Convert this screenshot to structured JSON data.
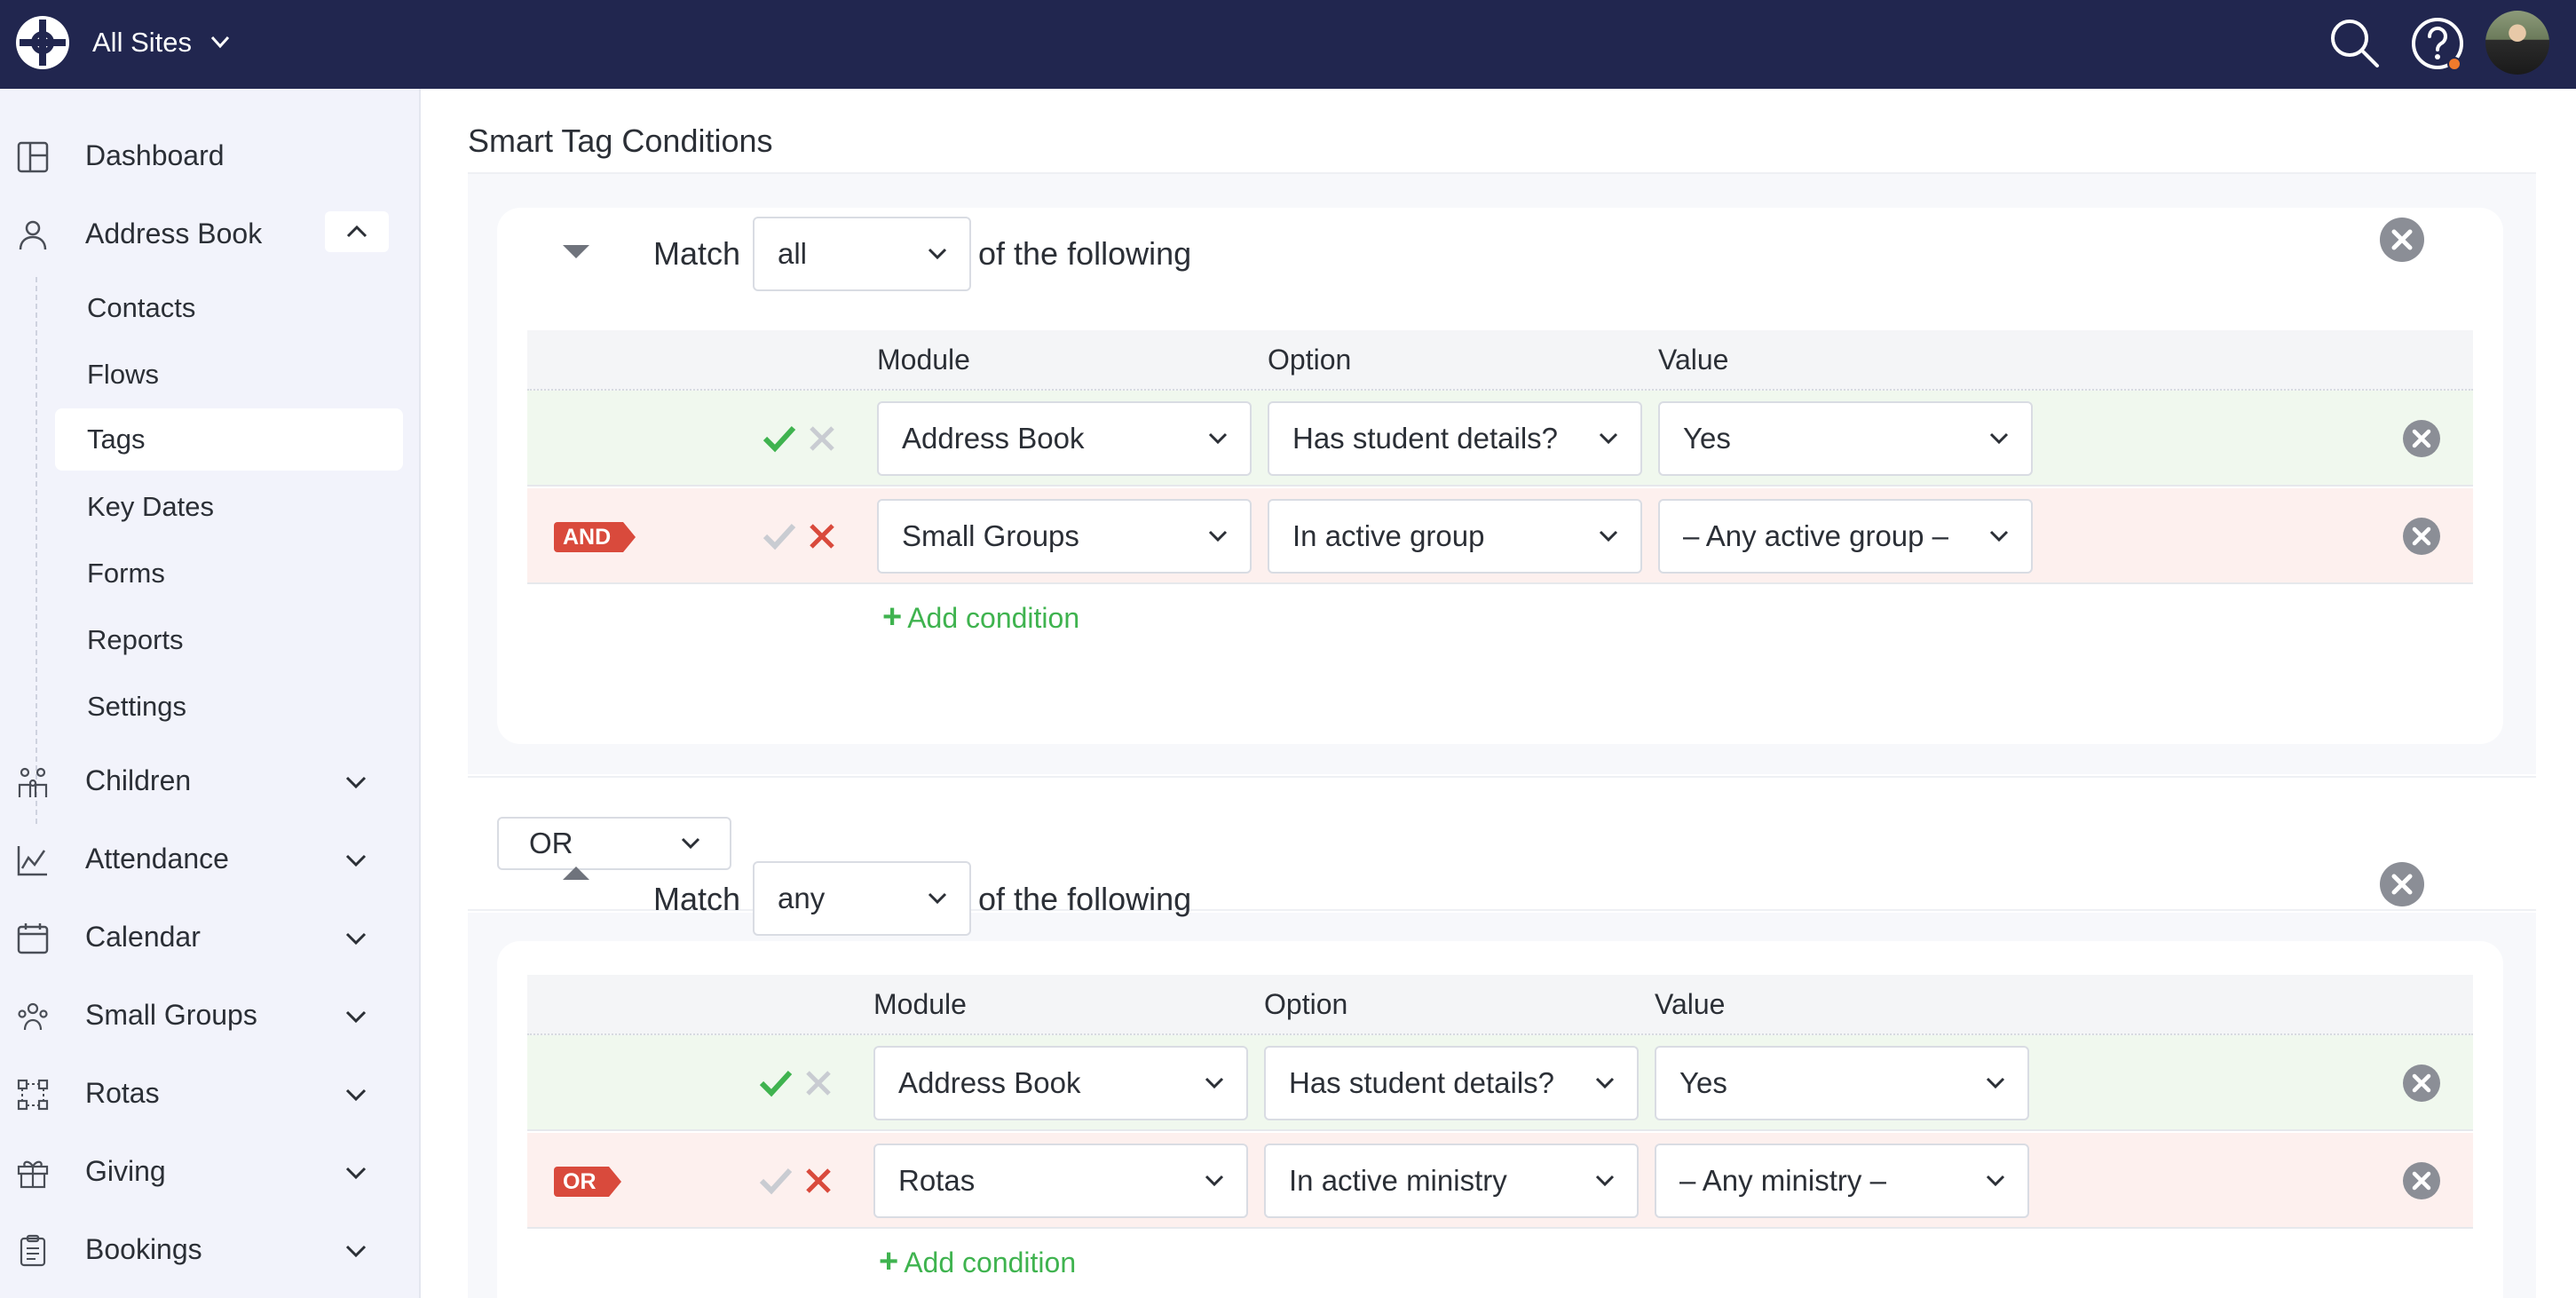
{
  "topbar": {
    "site_selector": "All Sites",
    "icons": [
      "logo-icon",
      "search-icon",
      "help-icon",
      "avatar"
    ],
    "colors": {
      "background": "#21264f",
      "notification_dot": "#f07a2c"
    }
  },
  "sidebar": {
    "items": [
      {
        "label": "Dashboard",
        "icon": "dashboard-icon"
      },
      {
        "label": "Address Book",
        "icon": "person-icon",
        "expanded": true
      },
      {
        "label": "Children",
        "icon": "children-icon"
      },
      {
        "label": "Attendance",
        "icon": "chart-icon"
      },
      {
        "label": "Calendar",
        "icon": "calendar-icon"
      },
      {
        "label": "Small Groups",
        "icon": "group-icon"
      },
      {
        "label": "Rotas",
        "icon": "rotas-icon"
      },
      {
        "label": "Giving",
        "icon": "gift-icon"
      },
      {
        "label": "Bookings",
        "icon": "clipboard-icon"
      }
    ],
    "address_book_sub": [
      "Contacts",
      "Flows",
      "Tags",
      "Key Dates",
      "Forms",
      "Reports",
      "Settings"
    ],
    "active_sub": "Tags"
  },
  "main": {
    "title": "Smart Tag Conditions",
    "columns": {
      "module": "Module",
      "option": "Option",
      "value": "Value"
    },
    "add_condition": "Add condition",
    "match_prefix": "Match",
    "match_suffix": "of the following",
    "groups": [
      {
        "match": "all",
        "conditions": [
          {
            "module": "Address Book",
            "option": "Has student details?",
            "value": "Yes",
            "state": "ok"
          },
          {
            "logic": "AND",
            "module": "Small Groups",
            "option": "In active group",
            "value": "– Any active group –",
            "state": "bad"
          }
        ]
      },
      {
        "match": "any",
        "conditions": [
          {
            "module": "Address Book",
            "option": "Has student details?",
            "value": "Yes",
            "state": "ok"
          },
          {
            "logic": "OR",
            "module": "Rotas",
            "option": "In active ministry",
            "value": "– Any ministry –",
            "state": "bad"
          }
        ]
      }
    ],
    "between_groups": "OR"
  },
  "colors": {
    "accent_green": "#3fb34f",
    "danger_red": "#d94a3c",
    "row_ok": "#f0f8ee",
    "row_bad": "#fdf0ee"
  }
}
